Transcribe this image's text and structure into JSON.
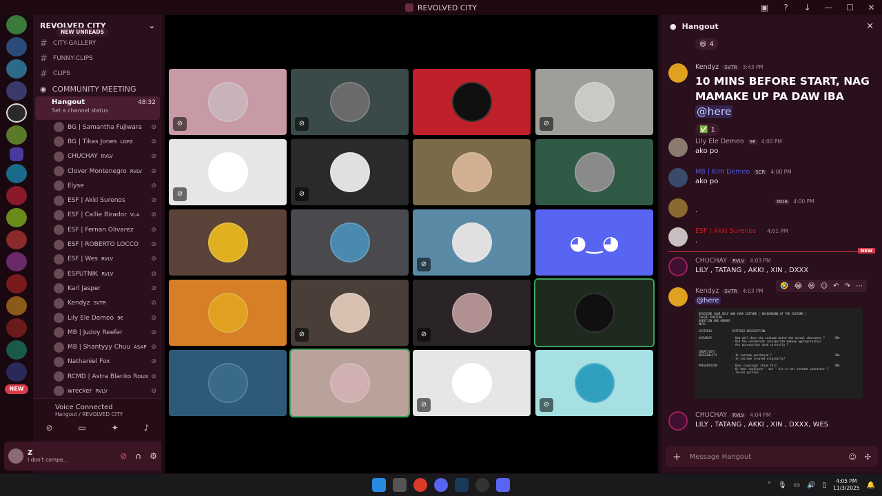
{
  "window": {
    "title": "REVOLVED CITY"
  },
  "guild": {
    "name": "REVOLVED CITY"
  },
  "channels": {
    "new_unreads": "NEW UNREADS",
    "list": [
      "CITY-GALLERY",
      "FUNNY-CLIPS",
      "CLIPS"
    ],
    "community": "COMMUNITY MEETING",
    "hangout": {
      "name": "Hangout",
      "time": "48:32",
      "status": "Set a channel status"
    }
  },
  "members": [
    {
      "name": "BG | Samantha Fujiwara",
      "badge": ""
    },
    {
      "name": "BG | Tikas Jones",
      "badge": "LOPZ"
    },
    {
      "name": "CHUCHAY",
      "badge": "RVLV"
    },
    {
      "name": "Clover Montenegro",
      "badge": "RVLV"
    },
    {
      "name": "Elyse",
      "badge": ""
    },
    {
      "name": "ESF | Akki Surenos",
      "badge": ""
    },
    {
      "name": "ESF | Callie Birador",
      "badge": "VLA"
    },
    {
      "name": "ESF | Fernan Olivarez",
      "badge": ""
    },
    {
      "name": "ESF | ROBERTO LOCCO",
      "badge": ""
    },
    {
      "name": "ESF | Wes",
      "badge": "RVLV"
    },
    {
      "name": "ESPUTNIK",
      "badge": "RVLV"
    },
    {
      "name": "Karl Jasper",
      "badge": ""
    },
    {
      "name": "Kendyz",
      "badge": "SVTR"
    },
    {
      "name": "Lily Ele Demeo",
      "badge": "9€"
    },
    {
      "name": "MB | Judoy Reefer",
      "badge": ""
    },
    {
      "name": "MB | Shantyyy Chuu",
      "badge": "ASAP"
    },
    {
      "name": "Nathaniel Fox",
      "badge": ""
    },
    {
      "name": "RCMD | Astra Blanko Roux",
      "badge": ""
    },
    {
      "name": "wrecker",
      "badge": "RVLV"
    }
  ],
  "voice": {
    "connected": "Voice Connected",
    "location": "Hangout / REVOLVED CITY"
  },
  "user": {
    "name": "Z",
    "status": "I don't compe..."
  },
  "servers": {
    "new_badge": "NEW"
  },
  "chat": {
    "title": "Hangout",
    "reaction_count_1": "4",
    "messages": [
      {
        "author": "Kendyz",
        "tag": "SVTR",
        "time": "3:43 PM",
        "text": "10 MINS BEFORE START, NAG MAMAKE UP PA DAW IBA",
        "mention": "@here",
        "reaction": "1"
      },
      {
        "author": "Lily Ele Demeo",
        "tag": "9€",
        "time": "4:00 PM",
        "text": "ako po"
      },
      {
        "author": "MB | Kim Demeo",
        "tag": "SCR",
        "time": "4:00 PM",
        "text": "ako po"
      },
      {
        "author": "",
        "tag": "MOB",
        "time": "4:00 PM",
        "text": "."
      },
      {
        "author": "ESF | Akki Surenos",
        "tag": "",
        "time": "4:01 PM",
        "text": "."
      },
      {
        "author": "CHUCHAY",
        "tag": "RVLV",
        "time": "4:03 PM",
        "text": "LILY , TATANG , AKKI , XIN , DXXX"
      },
      {
        "author": "Kendyz",
        "tag": "SVTR",
        "time": "4:03 PM",
        "text": "@here"
      },
      {
        "author": "CHUCHAY",
        "tag": "RVLV",
        "time": "4:04 PM",
        "text": "LILY , TATANG , AKKI , XIN , DXXX, WES"
      }
    ],
    "new_label": "NEW",
    "doc_text": "DESCRIBE YOUR SELF AND YOUR COSTUME ( BACKGROUND OF THE COSTUME )\nTALENT PORTION\nQUESTION AND ANSWER\nMOTO\n\nCRITERIA            CRITERIA DESCRIPTION\n\nACCURACY            - How well does the costume match the actual character ?      30%\n                    - Did the contestant incorporate makeup appropriately?\n                    - Are accessories used correctly ?\n\nCREATIVITY\nORIGINALITY         - Is costume purchased ?                                      30%\n                    - Is costume created originally?\n\nPRESENTAION         - Does cosplayer stand for?                                   40%\n                    - Or does cosplayer ' act ' his or her costume character ?\n                    - Talent portion",
    "composer_placeholder": "Message Hangout"
  },
  "clock": {
    "time": "4:05 PM",
    "date": "11/3/2025"
  },
  "colors": {
    "accent": "#d93a49",
    "speaking": "#3fa45e",
    "discord": "#5865f2"
  }
}
